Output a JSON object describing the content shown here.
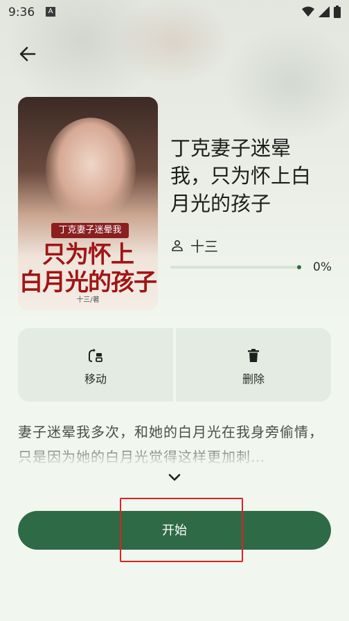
{
  "status_bar": {
    "time": "9:36",
    "notification_badge": "A"
  },
  "book": {
    "cover": {
      "subtitle": "丁克妻子迷晕我",
      "title_line1": "只为怀上",
      "title_line2": "白月光的孩子",
      "author": "十三/著"
    },
    "title": "丁克妻子迷晕我，只为怀上白月光的孩子",
    "author": "十三",
    "progress_text": "0%",
    "progress_fraction": 0.0
  },
  "actions": {
    "move_label": "移动",
    "delete_label": "删除"
  },
  "description": "妻子迷晕我多次，和她的白月光在我身旁偷情，只是因为她的白月光觉得这样更加刺…",
  "start_label": "开始",
  "colors": {
    "accent": "#2e6a45",
    "background": "#f1f6ef",
    "card": "#e4ebe2",
    "highlight": "#e02020"
  },
  "icons": [
    "back-arrow-icon",
    "person-icon",
    "move-icon",
    "trash-icon",
    "chevron-down-icon",
    "wifi-icon",
    "signal-icon",
    "battery-icon"
  ]
}
